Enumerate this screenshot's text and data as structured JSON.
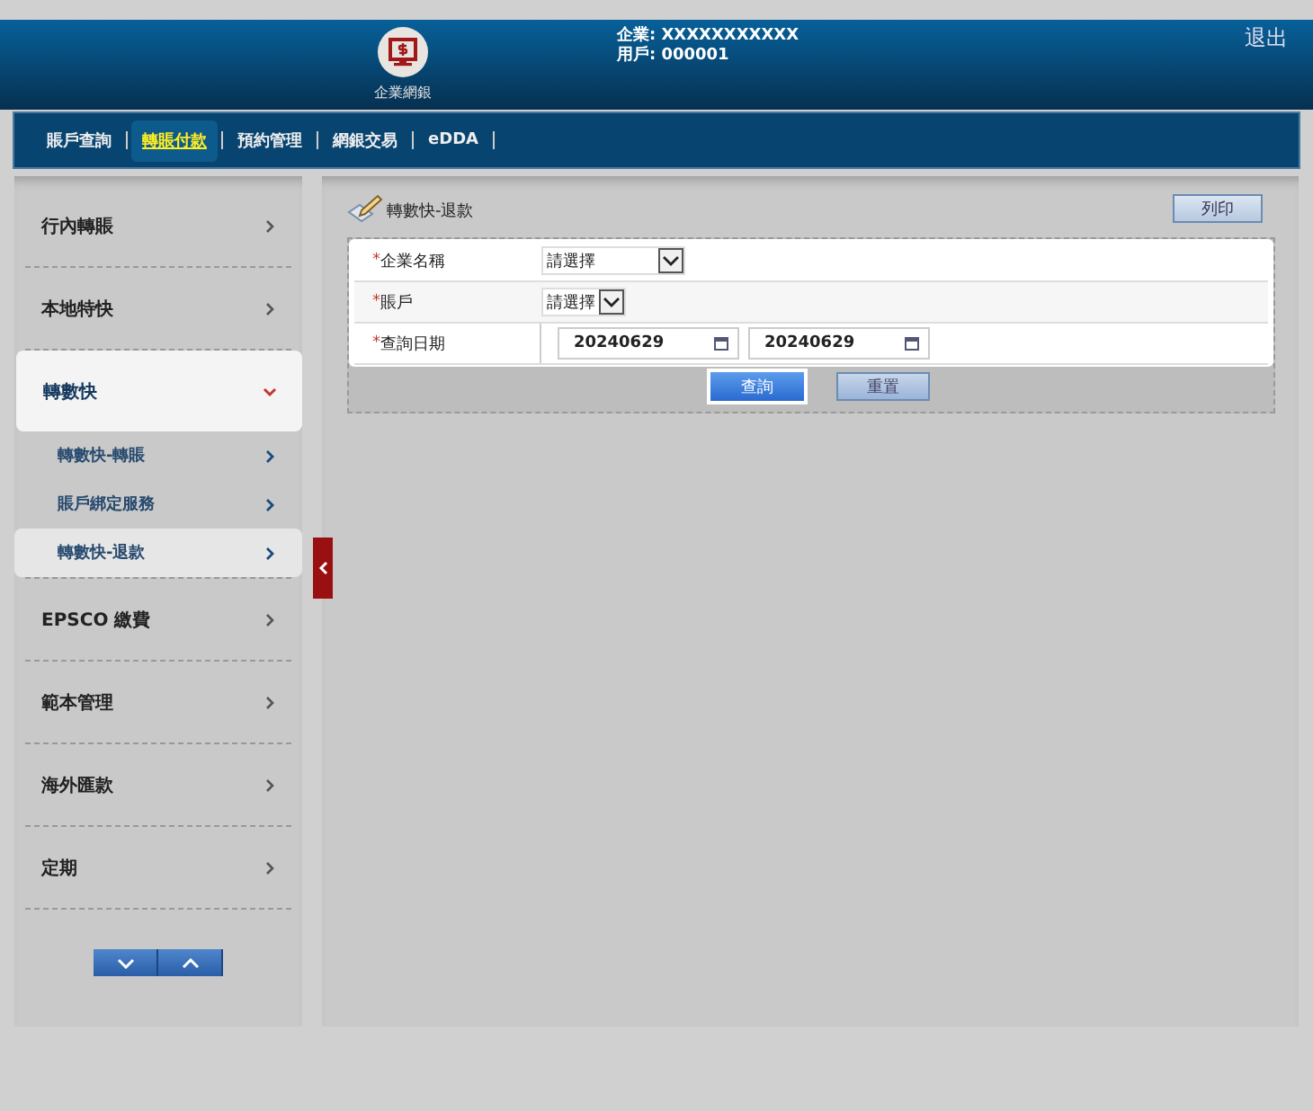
{
  "header": {
    "logo_label": "企業網銀",
    "company": "企業: XXXXXXXXXXX",
    "user": "用戶: 000001",
    "logout": "退出"
  },
  "nav": [
    {
      "label": "賬戶查詢",
      "selected": false
    },
    {
      "label": "轉賬付款",
      "selected": true
    },
    {
      "label": "預約管理",
      "selected": false
    },
    {
      "label": "網銀交易",
      "selected": false
    },
    {
      "label": "eDDA",
      "selected": false
    }
  ],
  "sidebar": {
    "items": [
      {
        "label": "行內轉賬",
        "expanded": false
      },
      {
        "label": "本地特快",
        "expanded": false
      },
      {
        "label": "轉數快",
        "expanded": true,
        "children": [
          {
            "label": "轉數快-轉賬",
            "selected": false
          },
          {
            "label": "賬戶綁定服務",
            "selected": false
          },
          {
            "label": "轉數快-退款",
            "selected": true
          }
        ]
      },
      {
        "label": "EPSCO 繳費",
        "expanded": false
      },
      {
        "label": "範本管理",
        "expanded": false
      },
      {
        "label": "海外匯款",
        "expanded": false
      },
      {
        "label": "定期",
        "expanded": false
      }
    ]
  },
  "page": {
    "title": "轉數快-退款",
    "print_button": "列印",
    "fields": [
      {
        "label": "企業名稱",
        "required_mark": "*",
        "kind": "select",
        "value": "請選擇"
      },
      {
        "label": "賬戶",
        "required_mark": "*",
        "kind": "select",
        "value": "請選擇"
      },
      {
        "label": "查詢日期",
        "required_mark": "*",
        "kind": "daterange",
        "from": "20240629",
        "to": "20240629"
      }
    ],
    "buttons": [
      {
        "label": "查詢",
        "kind": "primary"
      },
      {
        "label": "重置",
        "kind": "secondary"
      }
    ]
  }
}
